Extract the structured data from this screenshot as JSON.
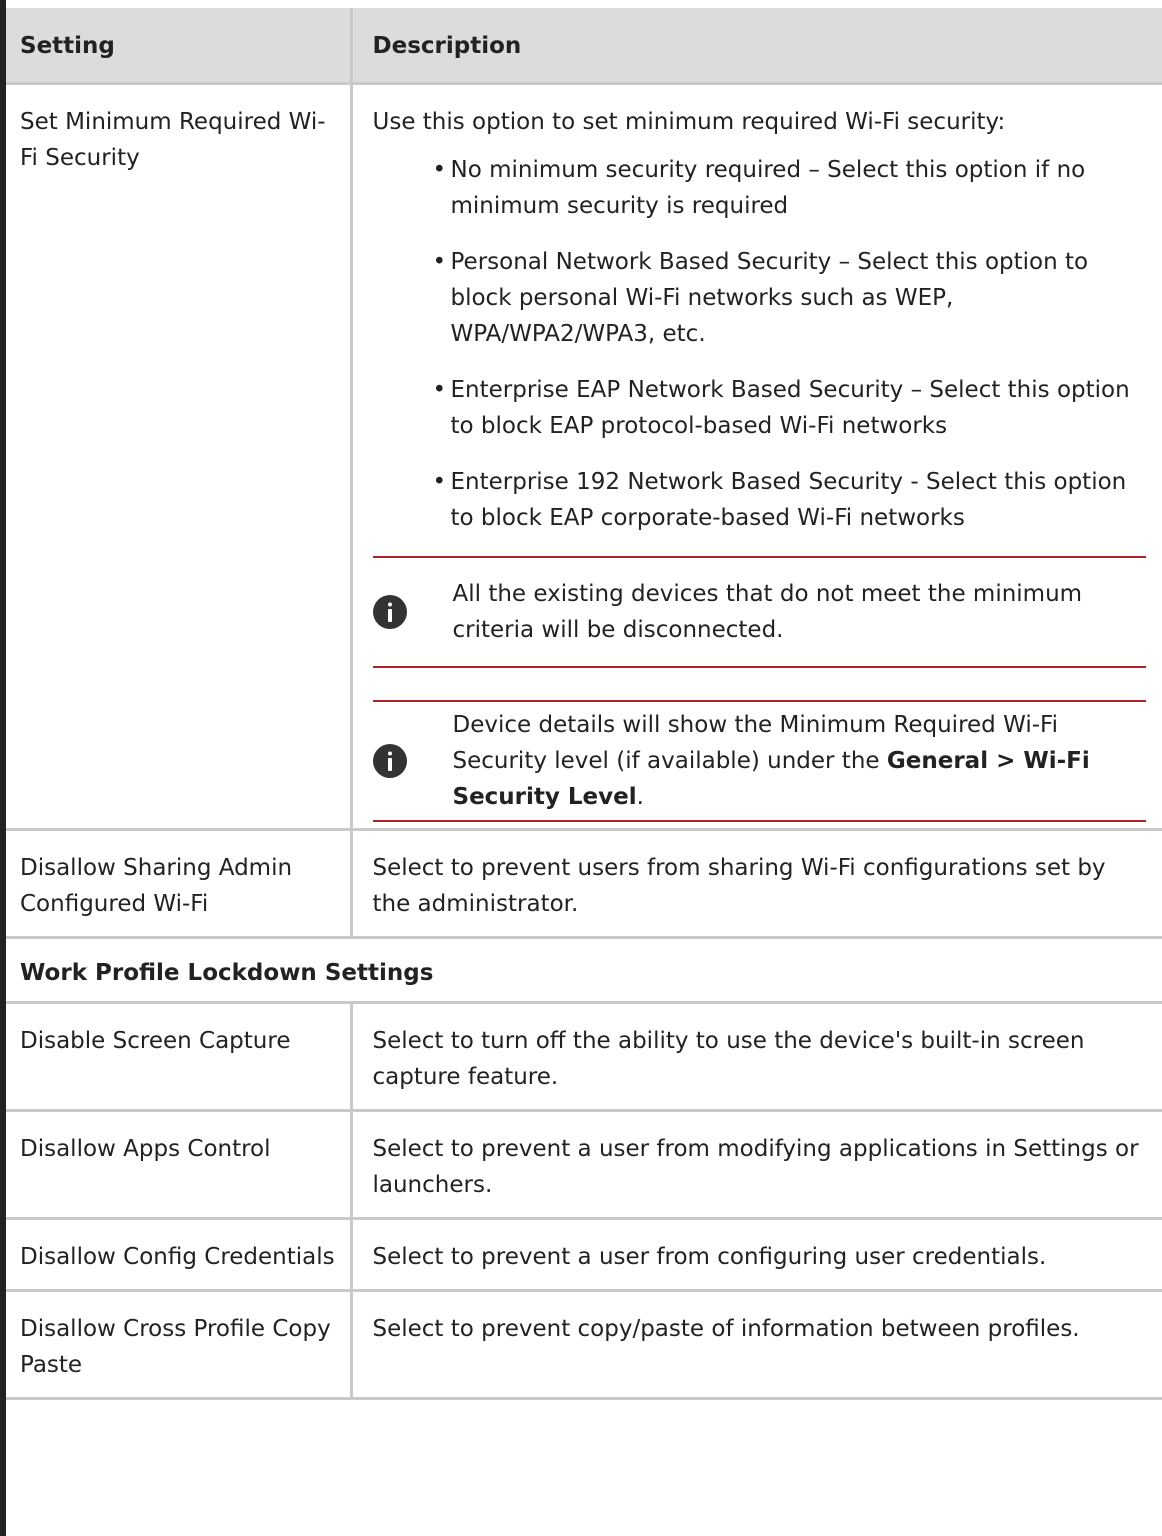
{
  "table": {
    "headers": {
      "setting": "Setting",
      "description": "Description"
    },
    "row_wifi_security": {
      "setting": "Set Minimum Required Wi-Fi Security",
      "intro": "Use this option to set minimum required Wi-Fi security:",
      "options": [
        "No minimum security required – Select this option if no minimum security is required",
        "Personal Network Based Security – Select this option to block personal Wi-Fi networks such as WEP, WPA/WPA2/WPA3, etc.",
        "Enterprise EAP Network Based Security – Select this option to block EAP protocol-based Wi-Fi networks",
        "Enterprise 192 Network Based Security - Select this option to block EAP corporate-based Wi-Fi networks"
      ],
      "note1": "All the existing devices that do not meet the minimum criteria will be disconnected.",
      "note2_prefix": "Device details will show the Minimum Required Wi-Fi Security level (if available) under the ",
      "note2_bold1": "General > Wi-Fi Security Level",
      "note2_suffix": "."
    },
    "row_sharing": {
      "setting": "Disallow Sharing Admin Configured Wi-Fi",
      "description": "Select to prevent users from sharing Wi-Fi configurations set by the administrator."
    },
    "section_title": "Work Profile Lockdown Settings",
    "lockdown_rows": [
      {
        "setting": "Disable Screen Capture",
        "description": "Select to turn off the ability to use the device's built-in screen capture feature."
      },
      {
        "setting": "Disallow Apps Control",
        "description": "Select to prevent a user from modifying applications in Settings or launchers."
      },
      {
        "setting": "Disallow Config Credentials",
        "description": "Select to prevent a user from configuring user credentials."
      },
      {
        "setting": "Disallow Cross Profile Copy Paste",
        "description": "Select to prevent copy/paste of information between profiles."
      }
    ]
  },
  "icons": {
    "note": "info-icon"
  },
  "colors": {
    "note_rule": "#b0202a",
    "header_bg": "#dcdcdc",
    "grid": "#c9c9c9"
  }
}
